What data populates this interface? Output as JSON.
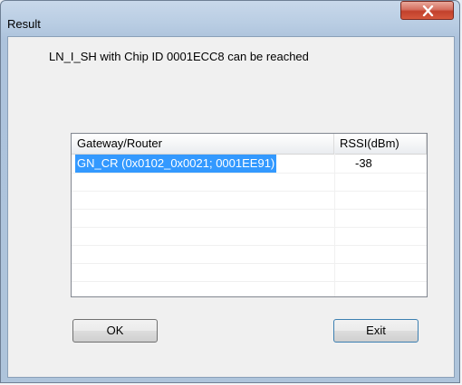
{
  "window": {
    "title": "Result",
    "close_icon": "close-x-icon"
  },
  "dialog": {
    "message": "LN_I_SH with Chip ID 0001ECC8 can be reached"
  },
  "table": {
    "columns": [
      "Gateway/Router",
      "RSSI(dBm)"
    ],
    "rows": [
      {
        "gateway": "GN_CR (0x0102_0x0021; 0001EE91)",
        "rssi": "-38",
        "selected": true
      }
    ]
  },
  "buttons": {
    "ok_label": "OK",
    "exit_label": "Exit"
  },
  "colors": {
    "selection": "#3399ff",
    "close_button": "#c2412c"
  }
}
